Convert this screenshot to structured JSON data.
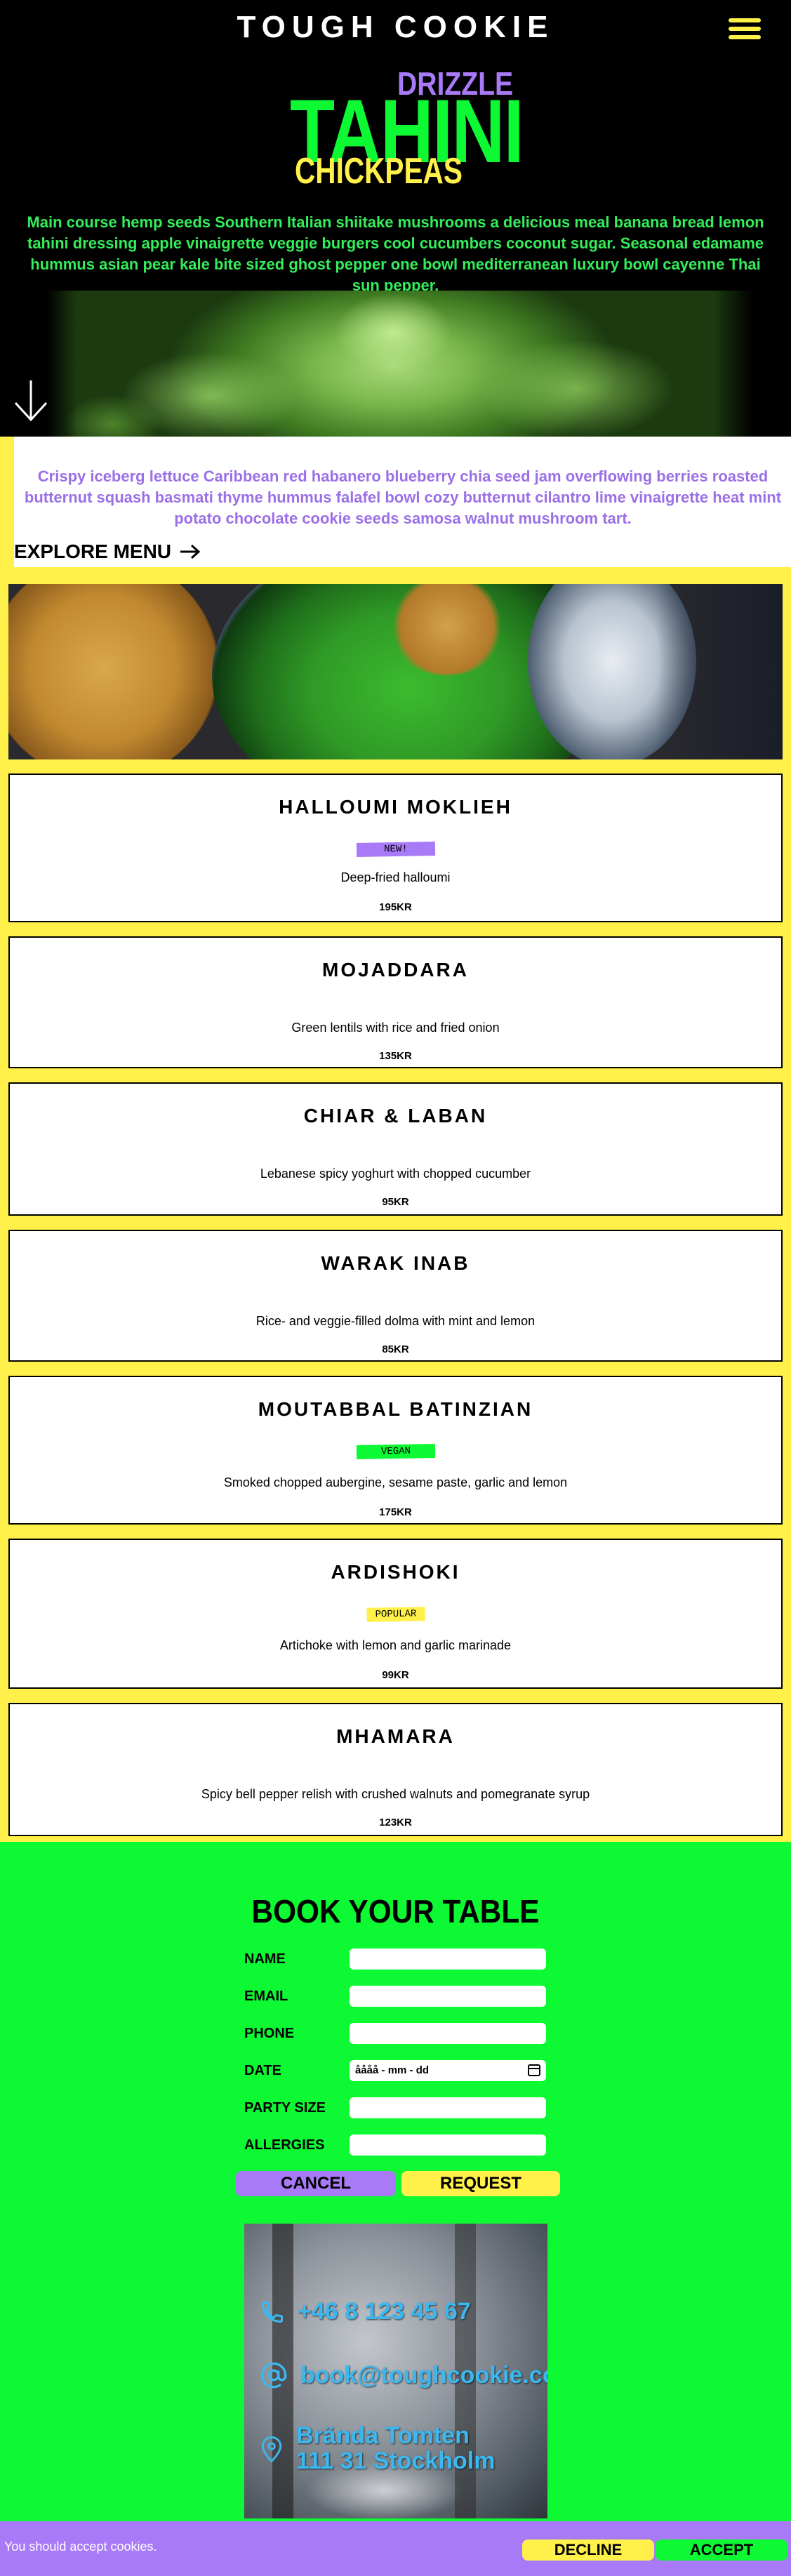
{
  "header": {
    "brand": "TOUGH COOKIE"
  },
  "hero": {
    "word_top": "DRIZZLE",
    "word_main": "TAHINI",
    "word_bottom": "CHICKPEAS",
    "text": "Main course hemp seeds Southern Italian shiitake mushrooms a delicious meal banana bread lemon tahini dressing apple vinaigrette veggie burgers cool cucumbers coconut sugar. Seasonal edamame hummus asian pear kale bite sized ghost pepper one bowl mediterranean luxury bowl cayenne Thai sun pepper."
  },
  "intro": {
    "text": "Crispy iceberg lettuce Caribbean red habanero blueberry chia seed jam overflowing berries roasted butternut squash basmati thyme hummus falafel bowl cozy butternut cilantro lime vinaigrette heat mint potato chocolate cookie seeds samosa walnut mushroom tart.",
    "explore_label": "EXPLORE MENU"
  },
  "menu": {
    "items": [
      {
        "name": "HALLOUMI MOKLIEH",
        "tag": "NEW!",
        "description": "Deep-fried halloumi",
        "price": "195KR"
      },
      {
        "name": "MOJADDARA",
        "tag": "",
        "description": "Green lentils with rice and fried onion",
        "price": "135KR"
      },
      {
        "name": "CHIAR & LABAN",
        "tag": "",
        "description": "Lebanese spicy yoghurt with chopped cucumber",
        "price": "95KR"
      },
      {
        "name": "WARAK INAB",
        "tag": "",
        "description": "Rice- and veggie-filled dolma with mint and lemon",
        "price": "85KR"
      },
      {
        "name": "MOUTABBAL BATINZIAN",
        "tag": "VEGAN",
        "description": "Smoked chopped aubergine, sesame paste, garlic and lemon",
        "price": "175KR"
      },
      {
        "name": "ARDISHOKI",
        "tag": "POPULAR",
        "description": "Artichoke with lemon and garlic marinade",
        "price": "99KR"
      },
      {
        "name": "MHAMARA",
        "tag": "",
        "description": "Spicy bell pepper relish with crushed walnuts and pomegranate syrup",
        "price": "123KR"
      }
    ]
  },
  "booking": {
    "title": "BOOK YOUR TABLE",
    "fields": {
      "name": "NAME",
      "email": "EMAIL",
      "phone": "PHONE",
      "date": "DATE",
      "party": "PARTY SIZE",
      "allergies": "ALLERGIES"
    },
    "date_placeholder": "åååå - mm - dd",
    "cancel_label": "CANCEL",
    "request_label": "REQUEST"
  },
  "contact": {
    "phone": "+46 8 123 45 67",
    "email": "book@toughcookie.com",
    "address_line1": "Brända Tomten",
    "address_line2": "111 31 Stockholm"
  },
  "cookie_bar": {
    "text": "You should accept cookies.",
    "decline_label": "DECLINE",
    "accept_label": "ACCEPT"
  },
  "colors": {
    "yellow": "#fff04a",
    "purple": "#a97af7",
    "green": "#0cf933",
    "black": "#000000",
    "contact_blue": "#3bb8f0"
  },
  "icons": {
    "menu": "hamburger-icon",
    "scroll": "arrow-down-icon",
    "explore": "arrow-right-icon",
    "phone": "phone-icon",
    "email": "at-icon",
    "location": "location-pin-icon",
    "date": "calendar-icon"
  }
}
